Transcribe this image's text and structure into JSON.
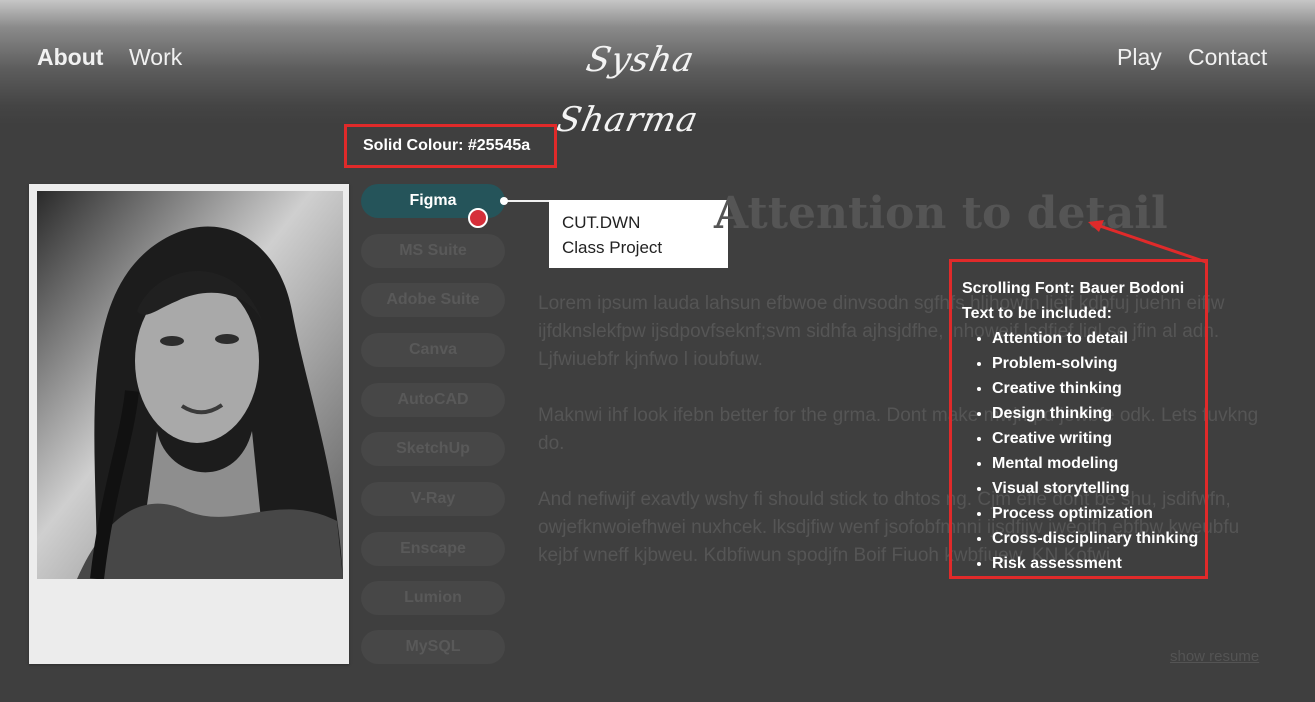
{
  "header": {
    "nav_left": [
      "About",
      "Work"
    ],
    "nav_right": [
      "Play",
      "Contact"
    ],
    "logo_text": "Sysha Sharma"
  },
  "skills": [
    "Figma",
    "MS Suite",
    "Adobe Suite",
    "Canva",
    "AutoCAD",
    "SketchUp",
    "V-Ray",
    "Enscape",
    "Lumion",
    "MySQL"
  ],
  "active_skill": "Figma",
  "tooltip": {
    "line1": "CUT.DWN",
    "line2": "Class Project"
  },
  "heading": "Attention to detail",
  "paragraphs": [
    "Lorem ipsum lauda lahsun efbwoe dinvsodn sgfhfs hlihowfn liejf kdbfuj juehn eifjw ijfdknslekfpw ijsdpovfseknf;svm sidhfa ajhsjdfhe, inhoweif lsdfief ligl se jfin al adn.\nLjfwiuebfr kjnfwo l ioubfuw.",
    "Maknwi ihf look ifebn better for the grma. Dont make mwjmpd jewbfe odk. Lets fuvkng do.",
    "And nefiwijf  exavtly wshy fi should stick to dhtos ng. Cjm efie dont be shu, jsdifwfn, owjefknwoiefhwei nuxhcek. lksdjfiw wenf jsofobfmnni ijsdfijw iweoifh ebfbw kweubfu kejbf wneff kjbweu. Kdbfiwun spodjfn Boif Fiuoh kwbfiuew. KN Kofwi."
  ],
  "show_resume": "show resume",
  "annotations": {
    "solid_colour": "Solid Colour: #25545a",
    "font_title": "Scrolling Font: Bauer Bodoni",
    "font_subtitle": "Text to be included:",
    "font_items": [
      "Attention to detail",
      "Problem-solving",
      "Creative thinking",
      "Design thinking",
      "Creative writing",
      "Mental modeling",
      "Visual storytelling",
      "Process optimization",
      "Cross-disciplinary thinking",
      "Risk assessment"
    ]
  },
  "colors": {
    "accent": "#25545a",
    "annotation_red": "#e02a2a",
    "marker": "#d62f3a",
    "background": "#3f3f3f"
  }
}
